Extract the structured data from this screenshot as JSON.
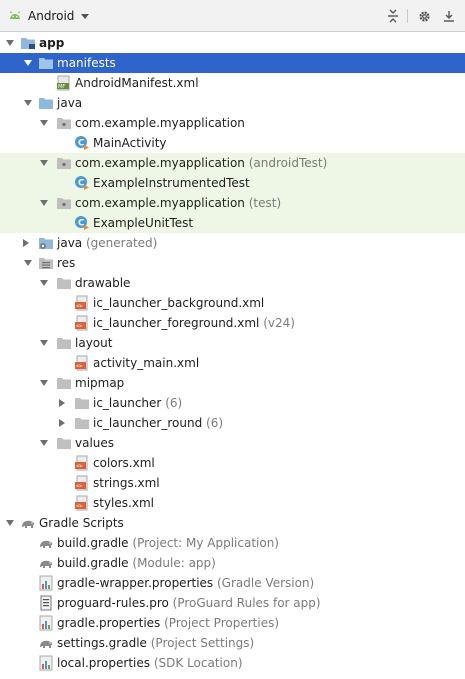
{
  "toolbar": {
    "title": "Android",
    "icons": [
      "android-icon",
      "chevron-down-icon",
      "collapse-all-icon",
      "gear-icon",
      "hide-icon"
    ]
  },
  "tree": {
    "app": "app",
    "manifests": "manifests",
    "android_manifest": "AndroidManifest.xml",
    "java": "java",
    "pkg_main": "com.example.myapplication",
    "main_activity": "MainActivity",
    "pkg_android_test": "com.example.myapplication",
    "pkg_android_test_sub": "(androidTest)",
    "example_instrumented_test": "ExampleInstrumentedTest",
    "pkg_test": "com.example.myapplication",
    "pkg_test_sub": "(test)",
    "example_unit_test": "ExampleUnitTest",
    "java_generated": "java",
    "java_generated_sub": "(generated)",
    "res": "res",
    "drawable": "drawable",
    "ic_launcher_background": "ic_launcher_background.xml",
    "ic_launcher_foreground": "ic_launcher_foreground.xml",
    "ic_launcher_foreground_sub": "(v24)",
    "layout": "layout",
    "activity_main": "activity_main.xml",
    "mipmap": "mipmap",
    "ic_launcher": "ic_launcher",
    "ic_launcher_sub": "(6)",
    "ic_launcher_round": "ic_launcher_round",
    "ic_launcher_round_sub": "(6)",
    "values": "values",
    "colors": "colors.xml",
    "strings": "strings.xml",
    "styles": "styles.xml",
    "gradle_scripts": "Gradle Scripts",
    "build_gradle_project": "build.gradle",
    "build_gradle_project_sub": "(Project: My Application)",
    "build_gradle_module": "build.gradle",
    "build_gradle_module_sub": "(Module: app)",
    "gradle_wrapper": "gradle-wrapper.properties",
    "gradle_wrapper_sub": "(Gradle Version)",
    "proguard": "proguard-rules.pro",
    "proguard_sub": "(ProGuard Rules for app)",
    "gradle_properties": "gradle.properties",
    "gradle_properties_sub": "(Project Properties)",
    "settings_gradle": "settings.gradle",
    "settings_gradle_sub": "(Project Settings)",
    "local_properties": "local.properties",
    "local_properties_sub": "(SDK Location)"
  },
  "colors": {
    "selection": "#2f65ca",
    "test_background": "#eef7e6",
    "secondary_text": "#7b7b7b",
    "folder_blue": "#8fb8dd",
    "android_green": "#78c257"
  }
}
